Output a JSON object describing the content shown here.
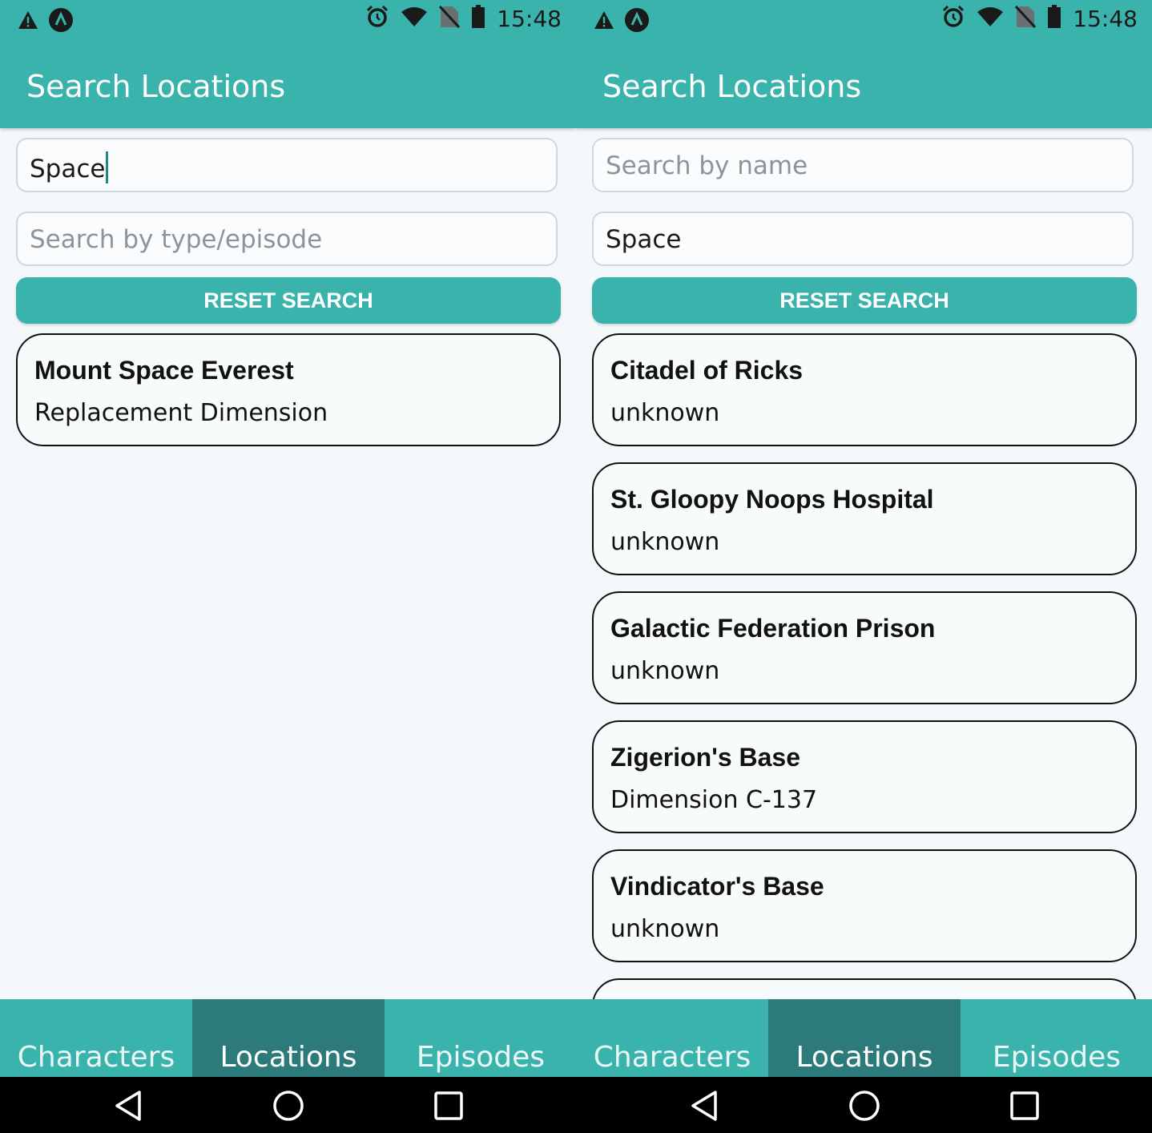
{
  "screens": [
    {
      "status": {
        "time": "15:48"
      },
      "app_title": "Search Locations",
      "name_search": {
        "value": "Space",
        "placeholder": "Search by name"
      },
      "type_search": {
        "value": "",
        "placeholder": "Search by type/episode"
      },
      "reset_label": "RESET SEARCH",
      "results": [
        {
          "name": "Mount Space Everest",
          "dimension": "Replacement Dimension"
        }
      ],
      "tabs": [
        {
          "label": "Characters",
          "active": false
        },
        {
          "label": "Locations",
          "active": true
        },
        {
          "label": "Episodes",
          "active": false
        }
      ]
    },
    {
      "status": {
        "time": "15:48"
      },
      "app_title": "Search Locations",
      "name_search": {
        "value": "",
        "placeholder": "Search by name"
      },
      "type_search": {
        "value": "Space",
        "placeholder": "Search by type/episode"
      },
      "reset_label": "RESET SEARCH",
      "results": [
        {
          "name": "Citadel of Ricks",
          "dimension": "unknown"
        },
        {
          "name": "St. Gloopy Noops Hospital",
          "dimension": "unknown"
        },
        {
          "name": "Galactic Federation Prison",
          "dimension": "unknown"
        },
        {
          "name": "Zigerion's Base",
          "dimension": "Dimension C-137"
        },
        {
          "name": "Vindicator's Base",
          "dimension": "unknown"
        }
      ],
      "tabs": [
        {
          "label": "Characters",
          "active": false
        },
        {
          "label": "Locations",
          "active": true
        },
        {
          "label": "Episodes",
          "active": false
        }
      ]
    }
  ],
  "icons": [
    "warning-icon",
    "app-notification-icon",
    "alarm-icon",
    "wifi-icon",
    "no-sim-icon",
    "battery-icon",
    "back-icon",
    "home-icon",
    "recents-icon"
  ],
  "colors": {
    "accent": "#3ab3ad",
    "active_tab": "#2c7a79",
    "background": "#f4f8fb",
    "card_border": "#111111"
  }
}
